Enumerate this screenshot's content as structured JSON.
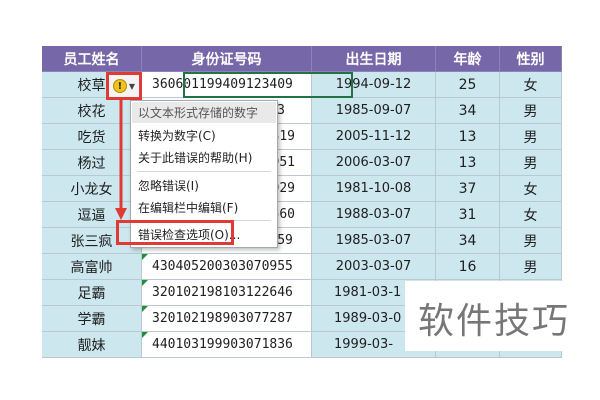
{
  "headers": [
    "员工姓名",
    "身份证号码",
    "出生日期",
    "年龄",
    "性别"
  ],
  "rows": [
    {
      "name": "校草",
      "id": "360601199409123409",
      "date": "1994-09-12",
      "age": "25",
      "gender": "女"
    },
    {
      "name": "校花",
      "id": "13",
      "date": "1985-09-07",
      "age": "34",
      "gender": "男"
    },
    {
      "name": "吃货",
      "id": "319",
      "date": "2005-11-12",
      "age": "13",
      "gender": "男"
    },
    {
      "name": "杨过",
      "id": "951",
      "date": "2006-03-07",
      "age": "13",
      "gender": "男"
    },
    {
      "name": "小龙女",
      "id": "029",
      "date": "1981-10-08",
      "age": "37",
      "gender": "女"
    },
    {
      "name": "逗逼",
      "id": "560",
      "date": "1988-03-07",
      "age": "31",
      "gender": "女"
    },
    {
      "name": "张三疯",
      "id": "430403199803071659",
      "date": "1985-03-07",
      "age": "34",
      "gender": "男"
    },
    {
      "name": "高富帅",
      "id": "430405200303070955",
      "date": "2003-03-07",
      "age": "16",
      "gender": "男"
    },
    {
      "name": "足霸",
      "id": "320102198103122646",
      "date": "1981-03-1",
      "age": "",
      "gender": ""
    },
    {
      "name": "学霸",
      "id": "320102198903077287",
      "date": "1989-03-0",
      "age": "",
      "gender": ""
    },
    {
      "name": "靓妹",
      "id": "440103199903071836",
      "date": "1999-03-",
      "age": "",
      "gender": ""
    }
  ],
  "menu": {
    "title": "以文本形式存储的数字",
    "convert": "转换为数字(C)",
    "help": "关于此错误的帮助(H)",
    "ignore": "忽略错误(I)",
    "edit": "在编辑栏中编辑(F)",
    "options": "错误检查选项(O)..."
  },
  "warning_icon": "warning-exclamation-icon",
  "watermark": "软件技巧",
  "colors": {
    "header": "#7667a9",
    "cell": "#cde7ef",
    "highlight": "#e03a34",
    "selection": "#217346"
  }
}
